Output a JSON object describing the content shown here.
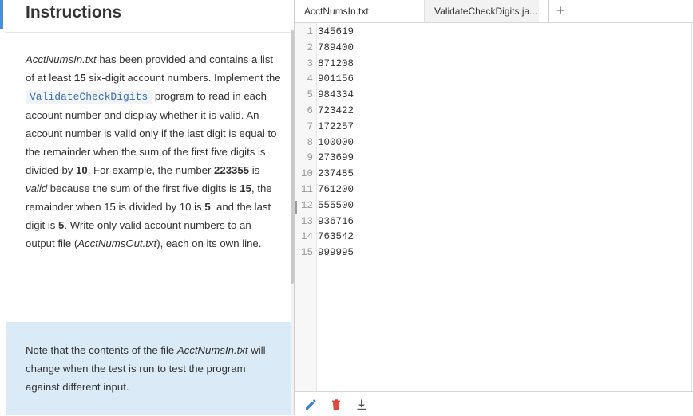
{
  "instructions_panel": {
    "title": "Instructions",
    "paragraph": {
      "s1_file": "AcctNumsIn.txt",
      "s1_rest": " has been provided and contains a list of at least ",
      "s1_num": "15",
      "s1_end": " six-digit account numbers. Implement the ",
      "program_name": "ValidateCheckDigits",
      "s2": " program to read in each account number and display whether it is valid. An account number is valid only if the last digit is equal to the remainder when the sum of the first five digits is divided by ",
      "s2_num": "10",
      "s2_end": ". For example, the number ",
      "example_num": "223355",
      "is_text": " is ",
      "valid_word": "valid",
      "s3": " because the sum of the first five digits is ",
      "sum_num": "15",
      "s3_mid": ", the remainder when 15 is divided by 10 is ",
      "rem_num": "5",
      "s3_end": ", and the last digit is ",
      "last_num": "5",
      "s4": ". Write only valid account numbers to an output file (",
      "out_file": "AcctNumsOut.txt",
      "s4_end": "), each on its own line."
    },
    "note": {
      "n1": "Note that the contents of the file ",
      "n_file": "AcctNumsIn.txt",
      "n2": " will change when the test is run to test the program against different input."
    }
  },
  "editor": {
    "tabs": [
      {
        "label": "AcctNumsIn.txt",
        "active": true
      },
      {
        "label": "ValidateCheckDigits.ja...",
        "active": false
      }
    ],
    "add_tab_label": "+",
    "lines": [
      {
        "n": "1",
        "text": "345619"
      },
      {
        "n": "2",
        "text": "789400"
      },
      {
        "n": "3",
        "text": "871208"
      },
      {
        "n": "4",
        "text": "901156"
      },
      {
        "n": "5",
        "text": "984334"
      },
      {
        "n": "6",
        "text": "723422"
      },
      {
        "n": "7",
        "text": "172257"
      },
      {
        "n": "8",
        "text": "100000"
      },
      {
        "n": "9",
        "text": "273699"
      },
      {
        "n": "10",
        "text": "237485"
      },
      {
        "n": "11",
        "text": "761200"
      },
      {
        "n": "12",
        "text": "555500"
      },
      {
        "n": "13",
        "text": "936716"
      },
      {
        "n": "14",
        "text": "763542"
      },
      {
        "n": "15",
        "text": "999995"
      }
    ]
  },
  "toolbar": {
    "icons": [
      "pencil-icon",
      "trash-icon",
      "download-icon"
    ]
  },
  "colors": {
    "accent": "#4a90d9",
    "note_bg": "#daeaf7",
    "pencil": "#3f7fd3",
    "trash": "#e0473f",
    "download": "#555555"
  }
}
